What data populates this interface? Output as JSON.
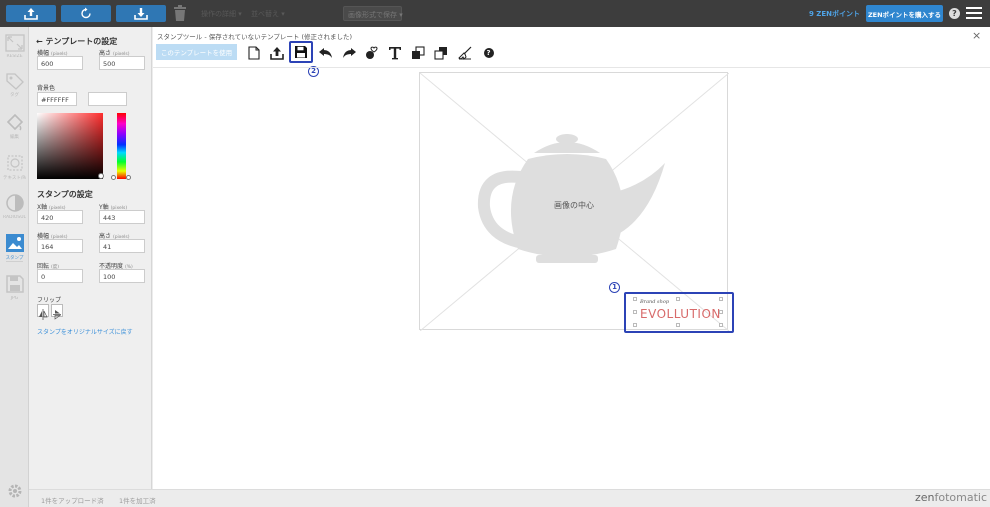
{
  "topbar": {
    "filter_label": "操作の詳細",
    "sort_label": "並べ替え",
    "save_format": "画像形式で保存",
    "points": "9 ZENポイント",
    "buy_points": "ZENポイントを購入する",
    "help": "?"
  },
  "rail": {
    "items": [
      {
        "label": "RESIZE"
      },
      {
        "label": "タグ"
      },
      {
        "label": "編集"
      },
      {
        "label": "テキスト/Rule"
      },
      {
        "label": "RADIOSUL"
      },
      {
        "label": "スタンプ"
      },
      {
        "label": "JPG"
      }
    ]
  },
  "template": {
    "title": "テンプレートの設定",
    "width_label": "横幅",
    "width_unit": "(pixels)",
    "width_value": "600",
    "height_label": "高さ",
    "height_unit": "(pixels)",
    "height_value": "500",
    "bg_label": "背景色",
    "bg_value": "#FFFFFF"
  },
  "stamp": {
    "title": "スタンプの設定",
    "x_label": "X軸",
    "x_unit": "(pixels)",
    "x_value": "420",
    "y_label": "Y軸",
    "y_unit": "(pixels)",
    "y_value": "443",
    "w_label": "横幅",
    "w_unit": "(pixels)",
    "w_value": "164",
    "h_label": "高さ",
    "h_unit": "(pixels)",
    "h_value": "41",
    "rot_label": "回転",
    "rot_unit": "(度)",
    "rot_value": "0",
    "opacity_label": "不透明度",
    "opacity_unit": "(%)",
    "opacity_value": "100",
    "flip_label": "フリップ",
    "orig_size_link": "スタンプをオリジナルサイズに戻す"
  },
  "editor": {
    "breadcrumb": "スタンプツール - 保存されていないテンプレート (修正されました)",
    "use_template": "このテンプレートを使用",
    "close": "×",
    "canvas_center": "画像の中心",
    "stamp_text": "EVOLLUTION",
    "stamp_subtext": "Brand shop",
    "callout_1": "1",
    "callout_2": "2",
    "help": "?"
  },
  "footer": {
    "uploaded": "1件をアップロード済",
    "processed": "1件を加工済",
    "brand_a": "zen",
    "brand_b": "fotomatic"
  },
  "colors": {
    "accent": "#2f77b4",
    "highlight": "#2c43b6",
    "stamp": "#d86a6a"
  }
}
